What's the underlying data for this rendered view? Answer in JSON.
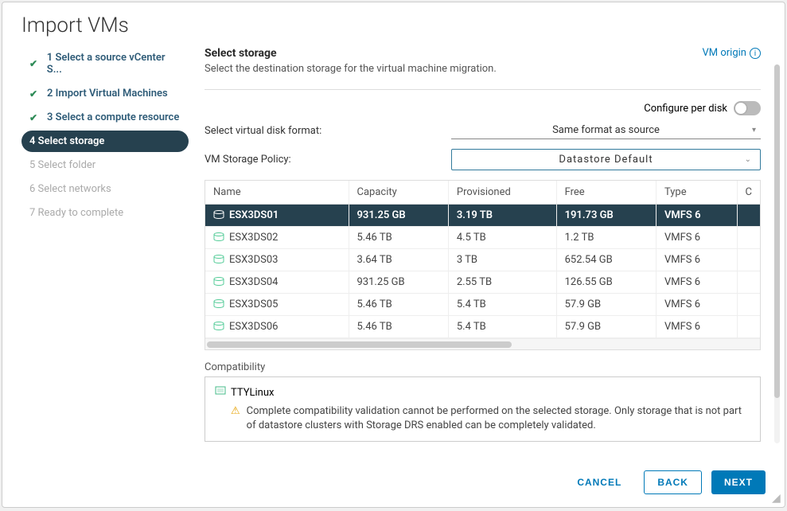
{
  "title": "Import VMs",
  "sidebar": {
    "steps": [
      {
        "label": "1 Select a source vCenter S...",
        "status": "completed"
      },
      {
        "label": "2 Import Virtual Machines",
        "status": "completed"
      },
      {
        "label": "3 Select a compute resource",
        "status": "completed"
      },
      {
        "label": "4 Select storage",
        "status": "active"
      },
      {
        "label": "5 Select folder",
        "status": "pending"
      },
      {
        "label": "6 Select networks",
        "status": "pending"
      },
      {
        "label": "7 Ready to complete",
        "status": "pending"
      }
    ]
  },
  "main": {
    "section_title": "Select storage",
    "section_subtitle": "Select the destination storage for the virtual machine migration.",
    "vm_origin": "VM origin",
    "configure_per_disk": "Configure per disk",
    "disk_format_label": "Select virtual disk format:",
    "disk_format_value": "Same format as source",
    "policy_label": "VM Storage Policy:",
    "policy_value": "Datastore Default",
    "columns": [
      "Name",
      "Capacity",
      "Provisioned",
      "Free",
      "Type",
      "C"
    ],
    "rows": [
      {
        "name": "ESX3DS01",
        "capacity": "931.25 GB",
        "provisioned": "3.19 TB",
        "free": "191.73 GB",
        "type": "VMFS 6",
        "selected": true
      },
      {
        "name": "ESX3DS02",
        "capacity": "5.46 TB",
        "provisioned": "4.5 TB",
        "free": "1.2 TB",
        "type": "VMFS 6"
      },
      {
        "name": "ESX3DS03",
        "capacity": "3.64 TB",
        "provisioned": "3 TB",
        "free": "652.54 GB",
        "type": "VMFS 6"
      },
      {
        "name": "ESX3DS04",
        "capacity": "931.25 GB",
        "provisioned": "2.55 TB",
        "free": "126.55 GB",
        "type": "VMFS 6"
      },
      {
        "name": "ESX3DS05",
        "capacity": "5.46 TB",
        "provisioned": "5.4 TB",
        "free": "57.9 GB",
        "type": "VMFS 6"
      },
      {
        "name": "ESX3DS06",
        "capacity": "5.46 TB",
        "provisioned": "5.4 TB",
        "free": "57.9 GB",
        "type": "VMFS 6"
      }
    ],
    "compat_label": "Compatibility",
    "compat_vm": "TTYLinux",
    "compat_msg": "Complete compatibility validation cannot be performed on the selected storage. Only storage that is not part of datastore clusters with Storage DRS enabled can be completely validated."
  },
  "footer": {
    "cancel": "CANCEL",
    "back": "BACK",
    "next": "NEXT"
  }
}
